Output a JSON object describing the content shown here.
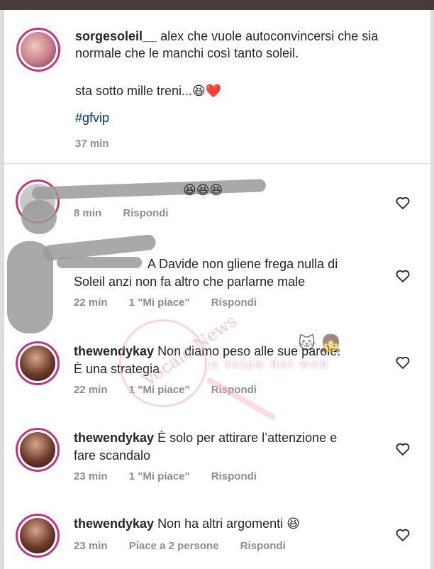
{
  "caption": {
    "username": "sorgesoleil__",
    "text": "alex che vuole autoconvincersi che sia normale che le manchi così tanto soleil.",
    "line2": "sta sotto mille treni...😆❤️",
    "hashtag": "#gfvip",
    "time": "37 min"
  },
  "comments": [
    {
      "text": "😆😆😆",
      "time": "8 min",
      "reply": "Rispondi"
    },
    {
      "line1": "A Davide non gliene frega nulla di",
      "line2": "Soleil anzi non fa altro che parlarne male",
      "time": "22 min",
      "likes": "1 \"Mi piace\"",
      "reply": "Rispondi"
    },
    {
      "username": "thewendykay",
      "line1": "Non diamo peso alle sue parole.",
      "line2": "È una strategia",
      "time": "22 min",
      "likes": "1 \"Mi piace\"",
      "reply": "Rispondi"
    },
    {
      "username": "thewendykay",
      "line1": "È solo per attirare l’attenzione e",
      "line2": "fare scandalo",
      "time": "23 min",
      "likes": "1 \"Mi piace\"",
      "reply": "Rispondi"
    },
    {
      "username": "thewendykay",
      "line1": "Non ha altri argomenti 😆",
      "time": "23 min",
      "likes": "Piace a 2 persone",
      "reply": "Rispondi"
    }
  ],
  "watermark": {
    "logo": "Vocalo News",
    "strip": "la talpa del web",
    "mascots": "🐱 👧"
  },
  "icons": {
    "like": "heart-outline-icon"
  },
  "colors": {
    "hashtag": "#00376b",
    "meta": "#8e8e8e",
    "ring": "#c13584",
    "watermark": "#f3b5cf"
  }
}
